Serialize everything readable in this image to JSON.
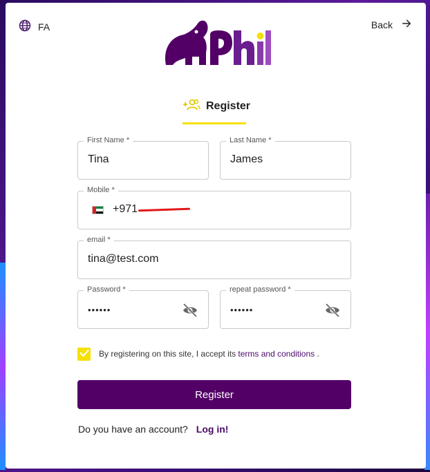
{
  "header": {
    "language_label": "FA",
    "back_label": "Back",
    "logo_text": "Phil"
  },
  "tab": {
    "label": "Register"
  },
  "form": {
    "first_name": {
      "label": "First Name *",
      "value": "Tina"
    },
    "last_name": {
      "label": "Last Name *",
      "value": "James"
    },
    "mobile": {
      "label": "Mobile *",
      "value": "+971"
    },
    "email": {
      "label": "email *",
      "value": "tina@test.com"
    },
    "password": {
      "label": "Password *",
      "value": "••••••"
    },
    "repeat_password": {
      "label": "repeat password *",
      "value": "••••••"
    }
  },
  "terms": {
    "checked": true,
    "text": "By registering on this site, I accept its ",
    "link": "terms and conditions",
    "suffix": " ."
  },
  "actions": {
    "register_label": "Register",
    "account_question": "Do you have an account?",
    "login_label": "Log in!"
  },
  "colors": {
    "brand_purple": "#520066",
    "accent_yellow": "#f5e000",
    "link_purple": "#4a0a6a"
  },
  "icons": {
    "language": "globe-icon",
    "back": "arrow-right-icon",
    "register_tab": "add-users-icon",
    "password_visibility": "eye-off-icon",
    "checkbox": "check-icon",
    "country_flag": "uae-flag-icon"
  }
}
